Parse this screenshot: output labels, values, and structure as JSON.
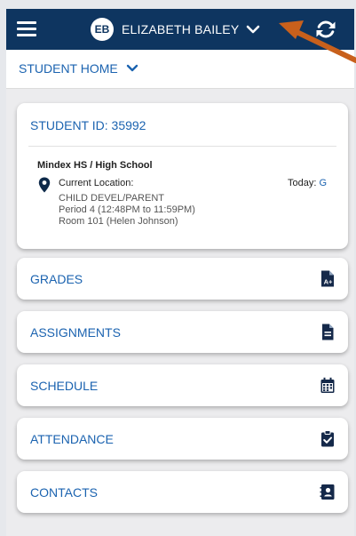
{
  "header": {
    "avatar_initials": "EB",
    "user_name": "ELIZABETH BAILEY",
    "menu_icon": "hamburger-menu-icon",
    "refresh_icon": "refresh-icon"
  },
  "subnav": {
    "label": "STUDENT HOME"
  },
  "student_card": {
    "student_id": "STUDENT ID: 35992",
    "school": "Mindex HS / High School",
    "location_label": "Current Location:",
    "today_label": "Today:",
    "today_value": "G",
    "location_lines": [
      "CHILD DEVEL/PARENT",
      "Period 4 (12:48PM to 11:59PM)",
      "Room 101 (Helen Johnson)"
    ]
  },
  "nav_items": [
    {
      "label": "GRADES",
      "icon": "grade-document-icon"
    },
    {
      "label": "ASSIGNMENTS",
      "icon": "document-icon"
    },
    {
      "label": "SCHEDULE",
      "icon": "calendar-icon"
    },
    {
      "label": "ATTENDANCE",
      "icon": "clipboard-check-icon"
    },
    {
      "label": "CONTACTS",
      "icon": "contact-card-icon"
    }
  ],
  "colors": {
    "header_bg": "#0e3560",
    "accent_blue": "#1b63b0",
    "annotation_arrow": "#c8601c"
  }
}
